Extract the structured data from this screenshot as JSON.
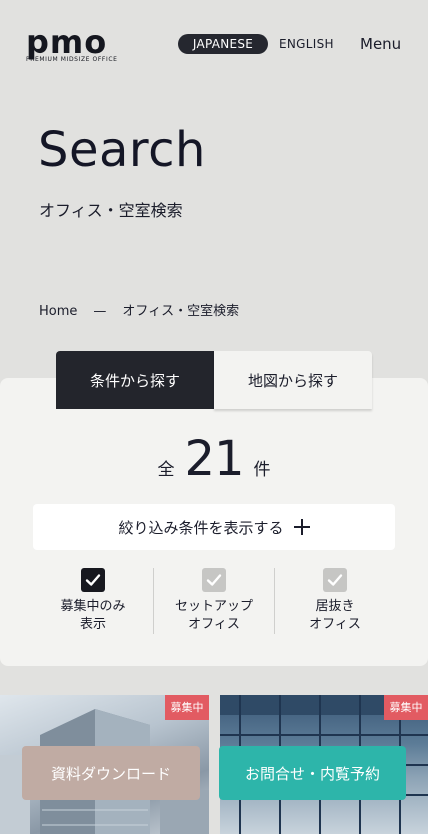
{
  "header": {
    "logo_text": "pmo",
    "logo_sub": "PREMIUM MIDSIZE OFFICE",
    "lang_japanese": "JAPANESE",
    "lang_english": "ENGLISH",
    "menu_label": "Menu"
  },
  "hero": {
    "title": "Search",
    "subtitle": "オフィス・空室検索"
  },
  "breadcrumb": {
    "home": "Home",
    "separator": "—",
    "current": "オフィス・空室検索"
  },
  "search": {
    "tabs": [
      {
        "label": "条件から探す",
        "active": true
      },
      {
        "label": "地図から探す",
        "active": false
      }
    ],
    "count_prefix": "全",
    "count": "21",
    "count_suffix": "件",
    "filter_button": "絞り込み条件を表示する",
    "checkboxes": [
      {
        "line1": "募集中のみ",
        "line2": "表示",
        "checked": true
      },
      {
        "line1": "セットアップ",
        "line2": "オフィス",
        "checked": false
      },
      {
        "line1": "居抜き",
        "line2": "オフィス",
        "checked": false
      }
    ]
  },
  "cards": {
    "badge_left": "募集中",
    "badge_right": "募集中"
  },
  "cta": {
    "download": "資料ダウンロード",
    "contact": "お問合せ・内覧予約"
  },
  "colors": {
    "background": "#e1e1df",
    "panel": "#f3f3f1",
    "dark": "#23252c",
    "badge": "#e25b62",
    "download": "#c0aba3",
    "contact": "#2db5aa"
  }
}
